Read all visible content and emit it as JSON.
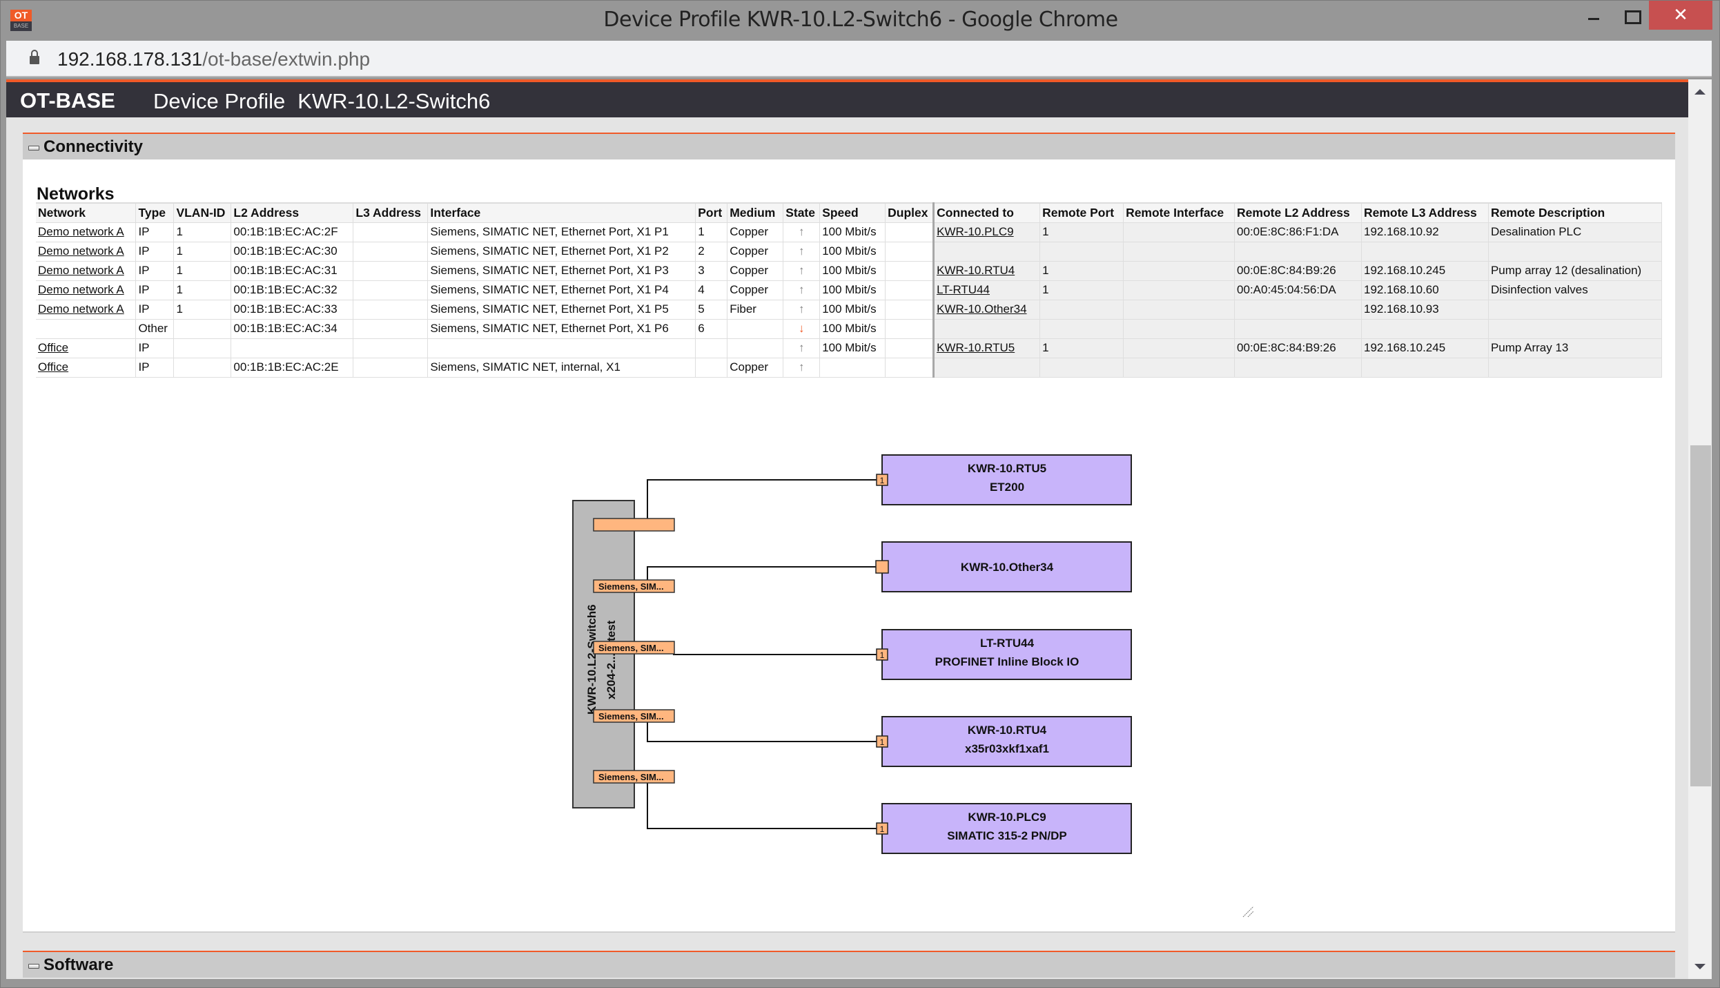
{
  "window": {
    "title": "Device Profile KWR-10.L2-Switch6 - Google Chrome",
    "app_icon_top": "OT",
    "app_icon_bottom": "BASE",
    "close_glyph": "✕"
  },
  "addressbar": {
    "host": "192.168.178.131",
    "path": "/ot-base/extwin.php"
  },
  "header": {
    "brand": "OT-BASE",
    "page_type": "Device Profile",
    "device_name": "KWR-10.L2-Switch6"
  },
  "sections": {
    "connectivity": "Connectivity",
    "software": "Software"
  },
  "networks": {
    "title": "Networks",
    "columns": [
      "Network",
      "Type",
      "VLAN-ID",
      "L2 Address",
      "L3 Address",
      "Interface",
      "Port",
      "Medium",
      "State",
      "Speed",
      "Duplex",
      "Connected to",
      "Remote Port",
      "Remote Interface",
      "Remote L2 Address",
      "Remote L3 Address",
      "Remote Description"
    ],
    "rows": [
      {
        "network": "Demo network A",
        "type": "IP",
        "vlan": "1",
        "l2": "00:1B:1B:EC:AC:2F",
        "l3": "",
        "iface": "Siemens, SIMATIC NET, Ethernet Port, X1 P1",
        "port": "1",
        "medium": "Copper",
        "state": "up",
        "speed": "100 Mbit/s",
        "duplex": "",
        "connected": "KWR-10.PLC9",
        "rport": "1",
        "riface": "",
        "rl2": "00:0E:8C:86:F1:DA",
        "rl3": "192.168.10.92",
        "rdesc": "Desalination PLC"
      },
      {
        "network": "Demo network A",
        "type": "IP",
        "vlan": "1",
        "l2": "00:1B:1B:EC:AC:30",
        "l3": "",
        "iface": "Siemens, SIMATIC NET, Ethernet Port, X1 P2",
        "port": "2",
        "medium": "Copper",
        "state": "up",
        "speed": "100 Mbit/s",
        "duplex": "",
        "connected": "",
        "rport": "",
        "riface": "",
        "rl2": "",
        "rl3": "",
        "rdesc": ""
      },
      {
        "network": "Demo network A",
        "type": "IP",
        "vlan": "1",
        "l2": "00:1B:1B:EC:AC:31",
        "l3": "",
        "iface": "Siemens, SIMATIC NET, Ethernet Port, X1 P3",
        "port": "3",
        "medium": "Copper",
        "state": "up",
        "speed": "100 Mbit/s",
        "duplex": "",
        "connected": "KWR-10.RTU4",
        "rport": "1",
        "riface": "",
        "rl2": "00:0E:8C:84:B9:26",
        "rl3": "192.168.10.245",
        "rdesc": "Pump array 12 (desalination)"
      },
      {
        "network": "Demo network A",
        "type": "IP",
        "vlan": "1",
        "l2": "00:1B:1B:EC:AC:32",
        "l3": "",
        "iface": "Siemens, SIMATIC NET, Ethernet Port, X1 P4",
        "port": "4",
        "medium": "Copper",
        "state": "up",
        "speed": "100 Mbit/s",
        "duplex": "",
        "connected": "LT-RTU44",
        "rport": "1",
        "riface": "",
        "rl2": "00:A0:45:04:56:DA",
        "rl3": "192.168.10.60",
        "rdesc": "Disinfection valves"
      },
      {
        "network": "Demo network A",
        "type": "IP",
        "vlan": "1",
        "l2": "00:1B:1B:EC:AC:33",
        "l3": "",
        "iface": "Siemens, SIMATIC NET, Ethernet Port, X1 P5",
        "port": "5",
        "medium": "Fiber",
        "state": "up",
        "speed": "100 Mbit/s",
        "duplex": "",
        "connected": "KWR-10.Other34",
        "rport": "",
        "riface": "",
        "rl2": "",
        "rl3": "192.168.10.93",
        "rdesc": ""
      },
      {
        "network": "",
        "type": "Other",
        "vlan": "",
        "l2": "00:1B:1B:EC:AC:34",
        "l3": "",
        "iface": "Siemens, SIMATIC NET, Ethernet Port, X1 P6",
        "port": "6",
        "medium": "",
        "state": "down",
        "speed": "100 Mbit/s",
        "duplex": "",
        "connected": "",
        "rport": "",
        "riface": "",
        "rl2": "",
        "rl3": "",
        "rdesc": ""
      },
      {
        "network": "Office",
        "type": "IP",
        "vlan": "",
        "l2": "",
        "l3": "",
        "iface": "",
        "port": "",
        "medium": "",
        "state": "up",
        "speed": "100 Mbit/s",
        "duplex": "",
        "connected": "KWR-10.RTU5",
        "rport": "1",
        "riface": "",
        "rl2": "00:0E:8C:84:B9:26",
        "rl3": "192.168.10.245",
        "rdesc": "Pump Array 13"
      },
      {
        "network": "Office",
        "type": "IP",
        "vlan": "",
        "l2": "00:1B:1B:EC:AC:2E",
        "l3": "",
        "iface": "Siemens, SIMATIC NET, internal, X1",
        "port": "",
        "medium": "Copper",
        "state": "up",
        "speed": "",
        "duplex": "",
        "connected": "",
        "rport": "",
        "riface": "",
        "rl2": "",
        "rl3": "",
        "rdesc": ""
      }
    ],
    "state_glyphs": {
      "up": "🡡",
      "down": "🡣"
    },
    "state_colors": {
      "up": "#808080",
      "down": "#f05a28"
    }
  },
  "topology": {
    "switch": {
      "name": "KWR-10.L2-Switch6",
      "model": "x204-2...rr.test"
    },
    "switch_ports": [
      "",
      "Siemens, SIM...",
      "Siemens, SIM...",
      "Siemens, SIM...",
      "Siemens, SIM..."
    ],
    "devices": [
      {
        "name": "KWR-10.RTU5",
        "model": "ET200",
        "port": "1"
      },
      {
        "name": "KWR-10.Other34",
        "model": "",
        "port": ""
      },
      {
        "name": "LT-RTU44",
        "model": "PROFINET Inline Block IO",
        "port": "1"
      },
      {
        "name": "KWR-10.RTU4",
        "model": "x35r03xkf1xaf1",
        "port": "1"
      },
      {
        "name": "KWR-10.PLC9",
        "model": "SIMATIC 315-2 PN/DP",
        "port": "1"
      }
    ],
    "colors": {
      "device_fill": "#c8b4fa",
      "port_fill": "#ffb67f",
      "switch_fill": "#bababa"
    }
  }
}
